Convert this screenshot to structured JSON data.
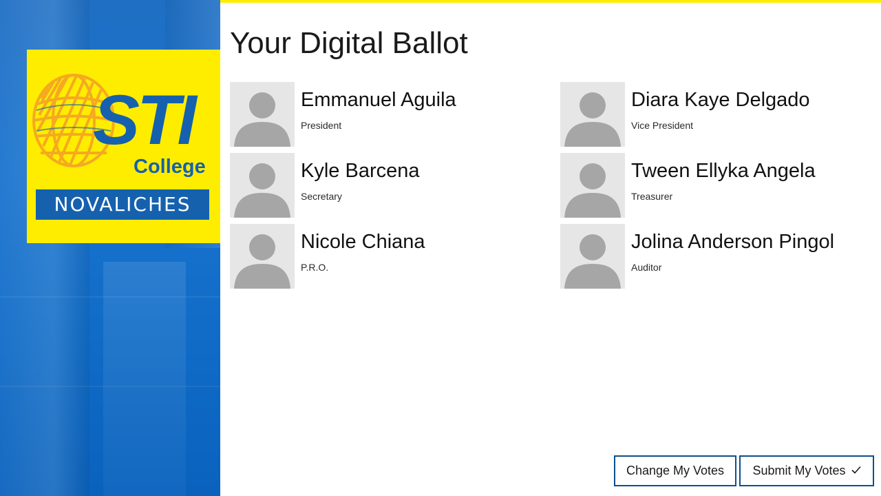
{
  "branding": {
    "logo_main": "STI",
    "logo_sub": "College",
    "logo_campus": "NOVALICHES",
    "brand_yellow": "#ffed00",
    "brand_blue": "#1561ae"
  },
  "page": {
    "title": "Your Digital Ballot"
  },
  "candidates": [
    {
      "name": "Emmanuel Aguila",
      "position": "President"
    },
    {
      "name": "Diara Kaye Delgado",
      "position": "Vice President"
    },
    {
      "name": "Kyle Barcena",
      "position": "Secretary"
    },
    {
      "name": "Tween Ellyka Angela",
      "position": "Treasurer"
    },
    {
      "name": "Nicole Chiana",
      "position": "P.R.O."
    },
    {
      "name": "Jolina Anderson Pingol",
      "position": "Auditor"
    }
  ],
  "actions": {
    "change_label": "Change My Votes",
    "submit_label": "Submit My Votes",
    "submit_icon": "checkmark-icon"
  }
}
